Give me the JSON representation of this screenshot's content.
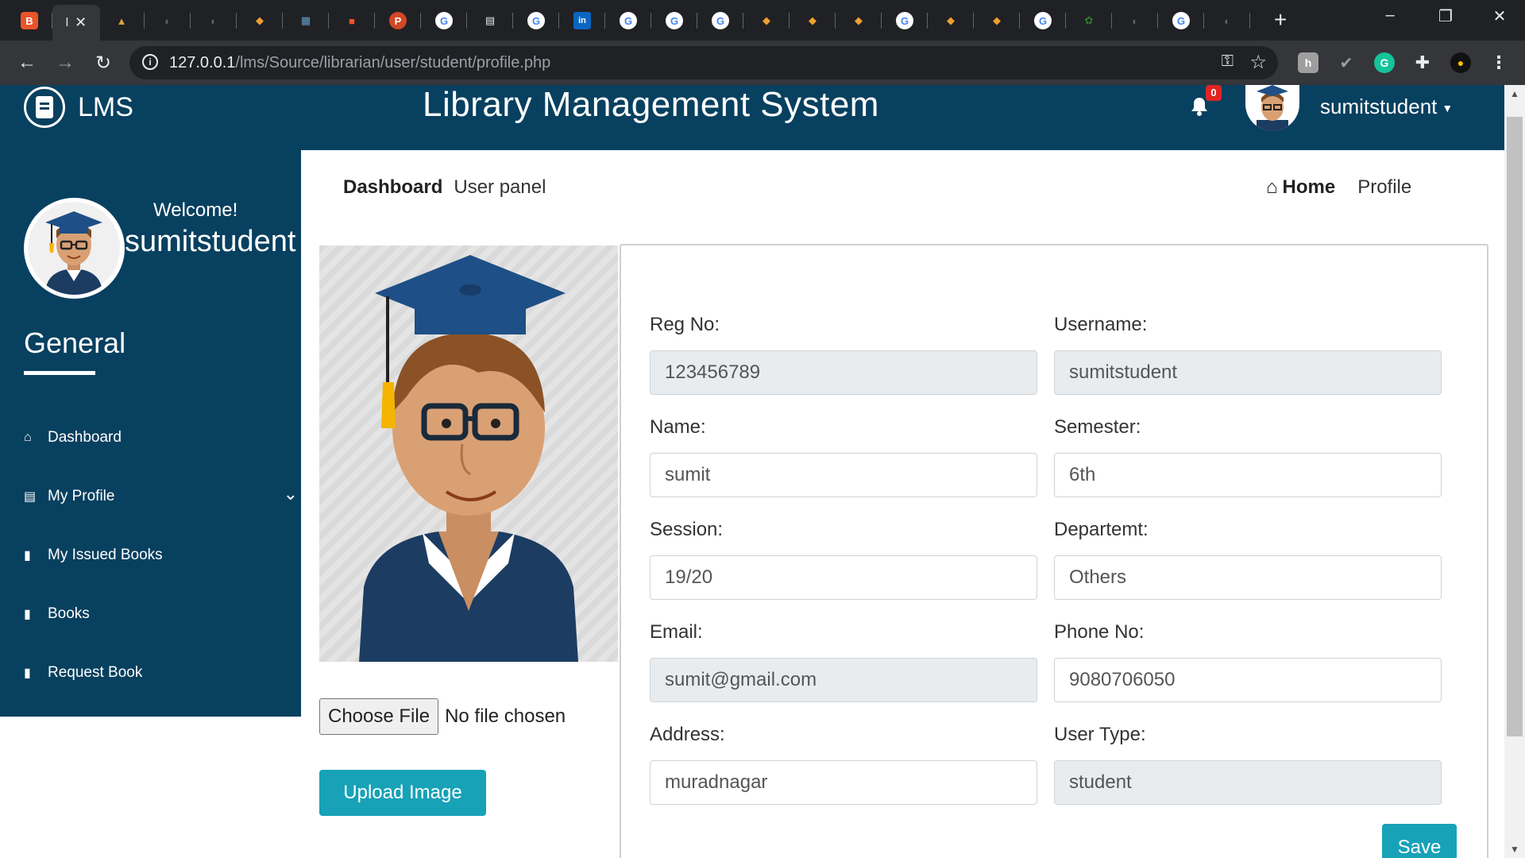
{
  "browser": {
    "tabs": [
      {
        "icon": "bitbucket-icon",
        "color": "#e8542a",
        "glyph": "B"
      },
      {
        "icon": "active-tab",
        "label": "l",
        "close": "✕"
      },
      {
        "icon": "mountain-icon",
        "color": "#d9a23a",
        "glyph": "▲"
      },
      {
        "icon": "globe-icon",
        "color": "#5f6368",
        "glyph": "◐"
      },
      {
        "icon": "globe-icon",
        "color": "#5f6368",
        "glyph": "◐"
      },
      {
        "icon": "shield-icon",
        "color": "#f0a030",
        "glyph": "◆"
      },
      {
        "icon": "map-icon",
        "color": "#5fa0c8",
        "glyph": "▦"
      },
      {
        "icon": "microsoft-icon",
        "color": "#f25022",
        "glyph": "■"
      },
      {
        "icon": "powerpoint-icon",
        "color": "#d24726",
        "glyph": "P"
      },
      {
        "icon": "google-icon",
        "color": "#ffffff",
        "glyph": "G"
      },
      {
        "icon": "printer-icon",
        "color": "#e8eaed",
        "glyph": "▤"
      },
      {
        "icon": "google-icon",
        "color": "#ffffff",
        "glyph": "G"
      },
      {
        "icon": "linkedin-icon",
        "color": "#0a66c2",
        "glyph": "in"
      },
      {
        "icon": "google-icon",
        "color": "#ffffff",
        "glyph": "G"
      },
      {
        "icon": "google-icon",
        "color": "#ffffff",
        "glyph": "G"
      },
      {
        "icon": "google-icon",
        "color": "#ffffff",
        "glyph": "G"
      },
      {
        "icon": "shield-icon",
        "color": "#f0a030",
        "glyph": "◆"
      },
      {
        "icon": "shield-icon",
        "color": "#f0a030",
        "glyph": "◆"
      },
      {
        "icon": "shield-icon",
        "color": "#f0a030",
        "glyph": "◆"
      },
      {
        "icon": "google-icon",
        "color": "#ffffff",
        "glyph": "G"
      },
      {
        "icon": "shield-icon",
        "color": "#f0a030",
        "glyph": "◆"
      },
      {
        "icon": "shield-icon",
        "color": "#f0a030",
        "glyph": "◆"
      },
      {
        "icon": "google-icon",
        "color": "#ffffff",
        "glyph": "G"
      },
      {
        "icon": "flower-icon",
        "color": "#2e7d32",
        "glyph": "✿"
      },
      {
        "icon": "globe-icon",
        "color": "#5f6368",
        "glyph": "◐"
      },
      {
        "icon": "google-icon",
        "color": "#ffffff",
        "glyph": "G"
      },
      {
        "icon": "globe-icon",
        "color": "#5f6368",
        "glyph": "◐"
      }
    ],
    "url_host": "127.0.0.1",
    "url_path": "/lms/Source/librarian/user/student/profile.php",
    "window_controls": [
      "–",
      "❐",
      "✕"
    ]
  },
  "header": {
    "logo_text": "LMS",
    "title": "Library Management System",
    "notification_count": "0",
    "username": "sumitstudent"
  },
  "sidebar": {
    "welcome": "Welcome!",
    "username": "sumitstudent",
    "section_title": "General",
    "items": [
      {
        "label": "Dashboard",
        "icon": "home-icon"
      },
      {
        "label": "My Profile",
        "icon": "id-card-icon",
        "expandable": true
      },
      {
        "label": "My Issued Books",
        "icon": "book-icon"
      },
      {
        "label": "Books",
        "icon": "book-icon"
      },
      {
        "label": "Request Book",
        "icon": "book-icon"
      }
    ]
  },
  "breadcrumb": {
    "title": "Dashboard",
    "subtitle": "User panel",
    "home": "Home",
    "current": "Profile"
  },
  "upload": {
    "choose_label": "Choose File",
    "status": "No file chosen",
    "button": "Upload Image"
  },
  "form": {
    "fields": [
      {
        "label": "Reg No:",
        "value": "123456789",
        "readonly": true
      },
      {
        "label": "Username:",
        "value": "sumitstudent",
        "readonly": true
      },
      {
        "label": "Name:",
        "value": "sumit",
        "readonly": false
      },
      {
        "label": "Semester:",
        "value": "6th",
        "readonly": false
      },
      {
        "label": "Session:",
        "value": "19/20",
        "readonly": false
      },
      {
        "label": "Departemt:",
        "value": "Others",
        "readonly": false
      },
      {
        "label": "Email:",
        "value": "sumit@gmail.com",
        "readonly": true
      },
      {
        "label": "Phone No:",
        "value": "9080706050",
        "readonly": false
      },
      {
        "label": "Address:",
        "value": "muradnagar",
        "readonly": false
      },
      {
        "label": "User Type:",
        "value": "student",
        "readonly": true
      }
    ],
    "save_label": "Save"
  },
  "colors": {
    "primary": "#08405f",
    "accent": "#17a2b8",
    "badge": "#e02424"
  }
}
